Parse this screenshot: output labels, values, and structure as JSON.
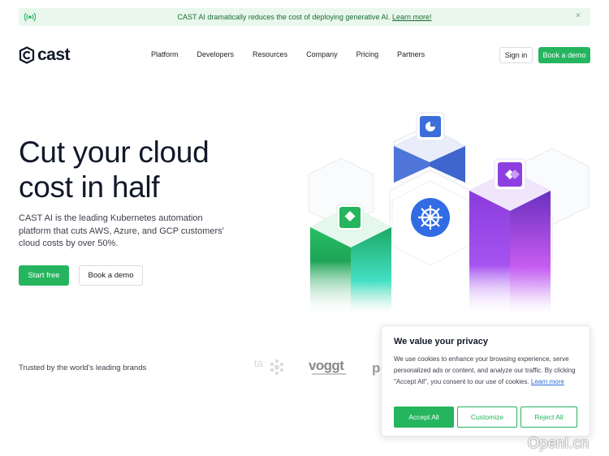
{
  "banner": {
    "text": "CAST AI dramatically reduces the cost of deploying generative AI.",
    "link": "Learn more!",
    "close": "×",
    "icon": "broadcast-icon"
  },
  "header": {
    "logo_text": "cast",
    "nav": [
      "Platform",
      "Developers",
      "Resources",
      "Company",
      "Pricing",
      "Partners"
    ],
    "sign_in": "Sign in",
    "book_demo": "Book a demo"
  },
  "hero": {
    "title_line1": "Cut your cloud",
    "title_line2": "cost in half",
    "description": "CAST AI is the leading Kubernetes automation platform that cuts AWS, Azure, and GCP customers' cloud costs by over 50%.",
    "start_free": "Start free",
    "book_demo": "Book a demo"
  },
  "trusted": {
    "label": "Trusted by the world's leading brands",
    "brands": [
      "ta",
      "voggt",
      "p"
    ]
  },
  "cookie": {
    "title": "We value your privacy",
    "text": "We use cookies to enhance your browsing experience, serve personalized ads or content, and analyze our traffic. By clicking \"Accept All\", you consent to our use of cookies.",
    "link": "Learn more",
    "accept": "Accept All",
    "customize": "Customize",
    "reject": "Reject All"
  },
  "watermark": "OpenI.cn",
  "colors": {
    "accent": "#25b55f",
    "banner_bg": "#e9f7ec",
    "blue": "#3b63c9",
    "purple": "#8a3fe0",
    "green": "#2fb55a"
  }
}
